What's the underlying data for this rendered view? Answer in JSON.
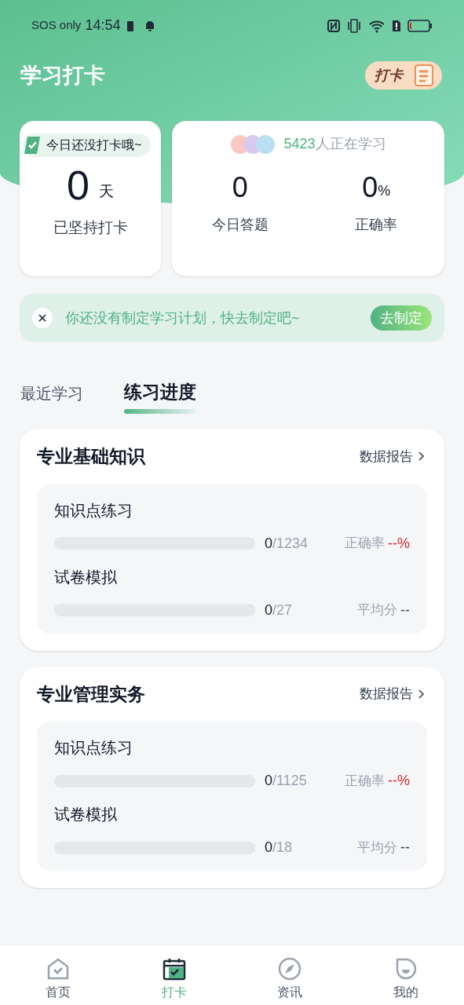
{
  "status_bar": {
    "carrier": "SOS only",
    "time": "14:54"
  },
  "header": {
    "title": "学习打卡",
    "badge": "打卡"
  },
  "streak_card": {
    "tag": "今日还没打卡哦~",
    "value": "0",
    "unit": "天",
    "label": "已坚持打卡"
  },
  "stats_card": {
    "learners_count": "5423",
    "learners_text": "人正在学习",
    "stats": [
      {
        "value": "0",
        "label": "今日答题"
      },
      {
        "value": "0",
        "unit": "%",
        "label": "正确率"
      }
    ]
  },
  "plan_banner": {
    "text": "你还没有制定学习计划，快去制定吧~",
    "button": "去制定"
  },
  "tabs": [
    {
      "label": "最近学习",
      "selected": false
    },
    {
      "label": "练习进度",
      "selected": true
    }
  ],
  "sections": [
    {
      "title": "专业基础知识",
      "link": "数据报告",
      "items": [
        {
          "kind": "accuracy",
          "name": "知识点练习",
          "level": 0,
          "done": "0",
          "total": "/1234",
          "stat_label": "正确率",
          "stat_value": "--%"
        },
        {
          "kind": "score",
          "name": "试卷模拟",
          "level": 0,
          "done": "0",
          "total": "/27",
          "stat_label": "平均分",
          "stat_value": "--"
        }
      ]
    },
    {
      "title": "专业管理实务",
      "link": "数据报告",
      "items": [
        {
          "kind": "accuracy",
          "name": "知识点练习",
          "level": 0,
          "done": "0",
          "total": "/1125",
          "stat_label": "正确率",
          "stat_value": "--%"
        },
        {
          "kind": "score",
          "name": "试卷模拟",
          "level": 0,
          "done": "0",
          "total": "/18",
          "stat_label": "平均分",
          "stat_value": "--"
        }
      ]
    }
  ],
  "nav": [
    {
      "kind": "home",
      "label": "首页",
      "selected": false
    },
    {
      "kind": "calendar",
      "label": "打卡",
      "selected": true
    },
    {
      "kind": "compass",
      "label": "资讯",
      "selected": false
    },
    {
      "kind": "profile",
      "label": "我的",
      "selected": false
    }
  ]
}
